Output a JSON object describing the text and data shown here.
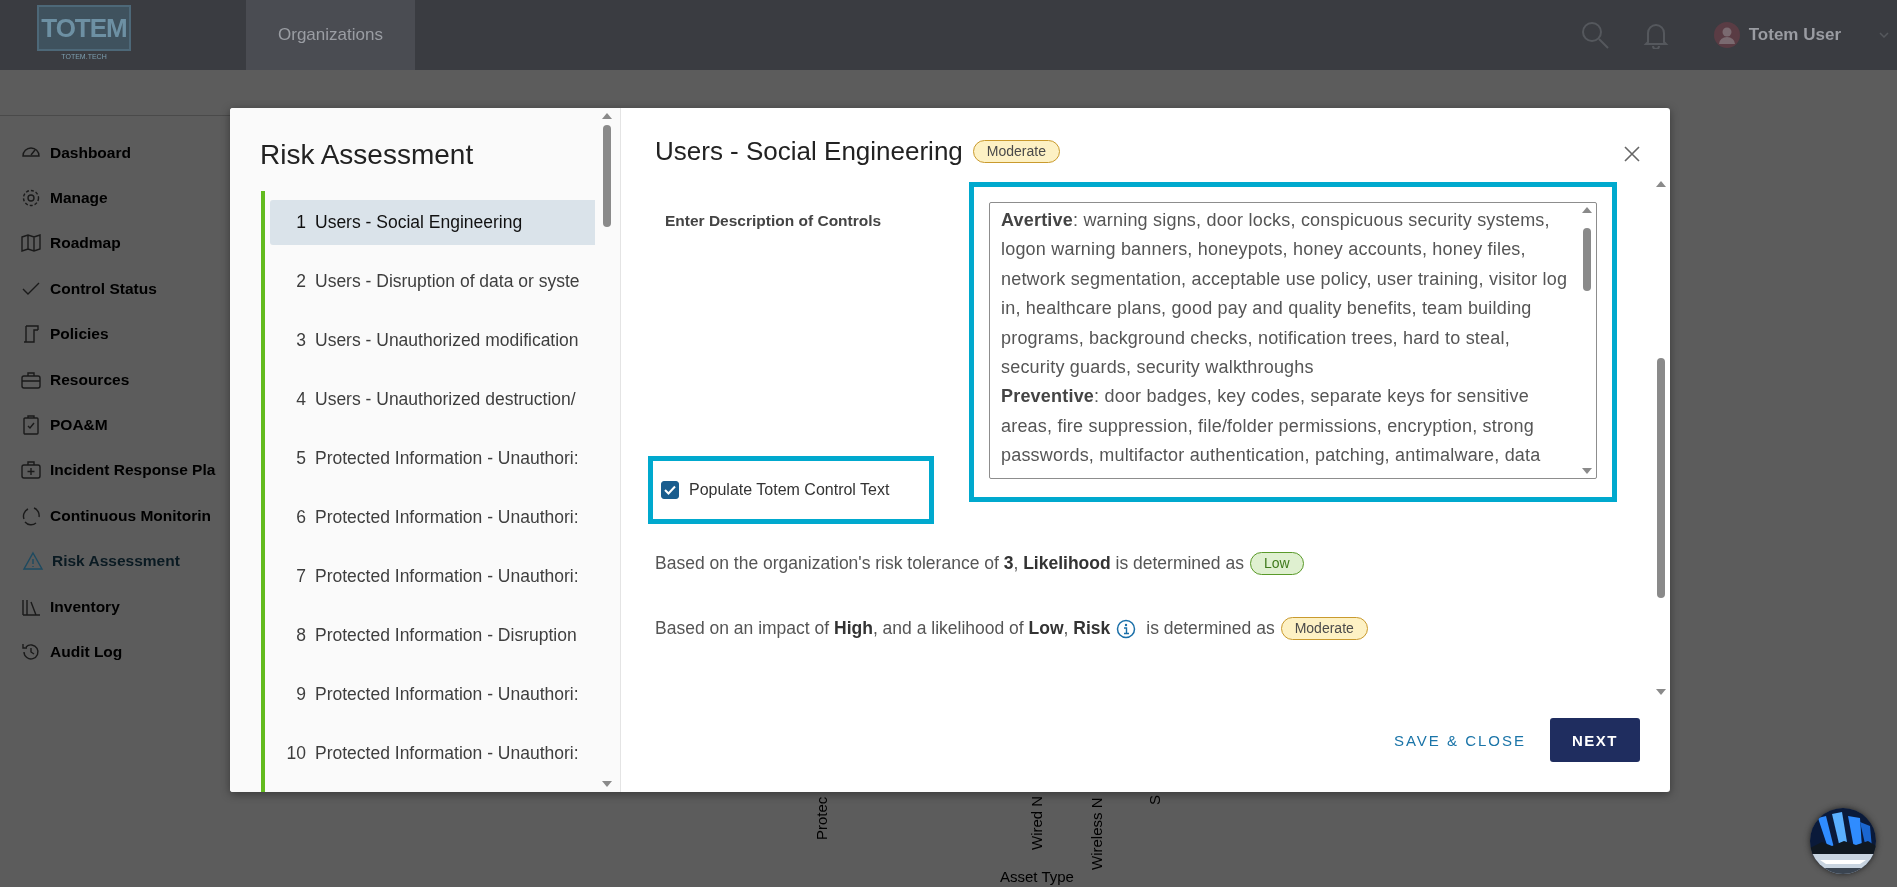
{
  "topbar": {
    "logo": "TOTEM",
    "logo_sub": "TOTEM.TECH",
    "nav": [
      {
        "label": "Organizations",
        "selected": true
      }
    ],
    "user": "Totem User"
  },
  "sidebar": {
    "items": [
      {
        "label": "Dashboard",
        "selected": false
      },
      {
        "label": "Manage",
        "selected": false
      },
      {
        "label": "Roadmap",
        "selected": false
      },
      {
        "label": "Control Status",
        "selected": false
      },
      {
        "label": "Policies",
        "selected": false
      },
      {
        "label": "Resources",
        "selected": false
      },
      {
        "label": "POA&M",
        "selected": false
      },
      {
        "label": "Incident Response Pla",
        "selected": false
      },
      {
        "label": "Continuous Monitorin",
        "selected": false
      },
      {
        "label": "Risk Assessment",
        "selected": true
      },
      {
        "label": "Inventory",
        "selected": false
      },
      {
        "label": "Audit Log",
        "selected": false
      }
    ]
  },
  "background_chart": {
    "labels": [
      "Protec",
      "Wired N",
      "Wireless N",
      "S"
    ],
    "axis_title": "Asset Type"
  },
  "modal": {
    "title": "Risk Assessment",
    "steps": [
      {
        "number": "1",
        "label": "Users - Social Engineering",
        "selected": true
      },
      {
        "number": "2",
        "label": "Users - Disruption of data or syste",
        "selected": false
      },
      {
        "number": "3",
        "label": "Users - Unauthorized modification",
        "selected": false
      },
      {
        "number": "4",
        "label": "Users - Unauthorized destruction/",
        "selected": false
      },
      {
        "number": "5",
        "label": "Protected Information - Unauthori:",
        "selected": false
      },
      {
        "number": "6",
        "label": "Protected Information - Unauthori:",
        "selected": false
      },
      {
        "number": "7",
        "label": "Protected Information - Unauthori:",
        "selected": false
      },
      {
        "number": "8",
        "label": "Protected Information - Disruption",
        "selected": false
      },
      {
        "number": "9",
        "label": "Protected Information - Unauthori:",
        "selected": false
      },
      {
        "number": "10",
        "label": "Protected Information - Unauthori:",
        "selected": false
      }
    ],
    "heading": "Users - Social Engineering",
    "heading_badge": {
      "label": "Moderate",
      "kind": "moderate"
    },
    "controls": {
      "label": "Enter Description of Controls",
      "highlighted": true,
      "paragraphs": [
        "**Avertive**: warning signs, door locks, conspicuous security systems, logon warning banners, honeypots, honey accounts, honey files, network segmentation, acceptable use policy, user training, visitor log in, healthcare plans, good pay and quality benefits, team building programs, background checks, notification trees, hard to steal, security guards, security walkthroughs",
        "**Preventive**: door badges, key codes, separate keys for sensitive areas, fire suppression, file/folder permissions, encryption, strong passwords, multifactor authentication, patching, antimalware, data"
      ]
    },
    "populate": {
      "label": "Populate Totem Control Text",
      "checked": true,
      "highlighted": true
    },
    "likelihood": {
      "text": "Based on the organization's risk tolerance of **3**, **Likelihood** is determined as",
      "badge": {
        "label": "Low",
        "kind": "low"
      }
    },
    "risk": {
      "text": "Based on an impact of **High**, and a likelihood of **Low**, **Risk**",
      "suffix": "is determined as",
      "badge": {
        "label": "Moderate",
        "kind": "moderate"
      }
    },
    "buttons": {
      "save": "SAVE & CLOSE",
      "next": "NEXT"
    }
  }
}
